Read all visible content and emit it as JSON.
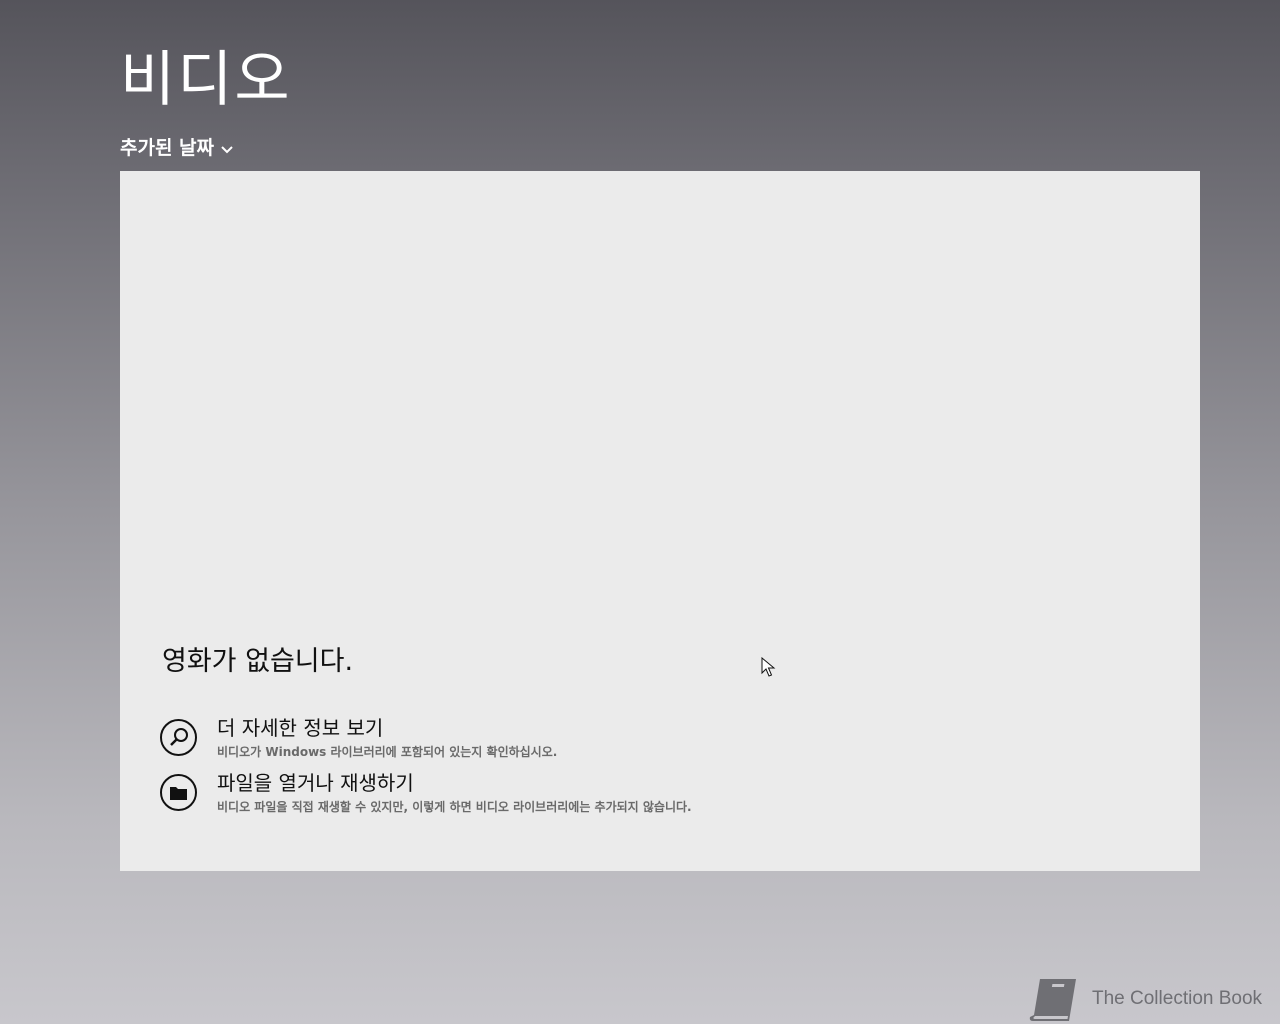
{
  "header": {
    "title": "비디오",
    "sort_label": "추가된 날짜"
  },
  "empty_state": {
    "heading": "영화가 없습니다.",
    "actions": [
      {
        "icon": "search-icon",
        "title": "더 자세한 정보 보기",
        "description": "비디오가 Windows 라이브러리에 포함되어 있는지 확인하십시오."
      },
      {
        "icon": "folder-icon",
        "title": "파일을 열거나 재생하기",
        "description": "비디오 파일을 직접 재생할 수 있지만, 이렇게 하면 비디오 라이브러리에는 추가되지 않습니다."
      }
    ]
  },
  "watermark": {
    "icon": "book-icon",
    "text": "The Collection Book"
  },
  "colors": {
    "panel_background": "#ebebeb",
    "header_text": "#ffffff",
    "body_text": "#111111",
    "secondary_text": "#6a6a6a"
  }
}
